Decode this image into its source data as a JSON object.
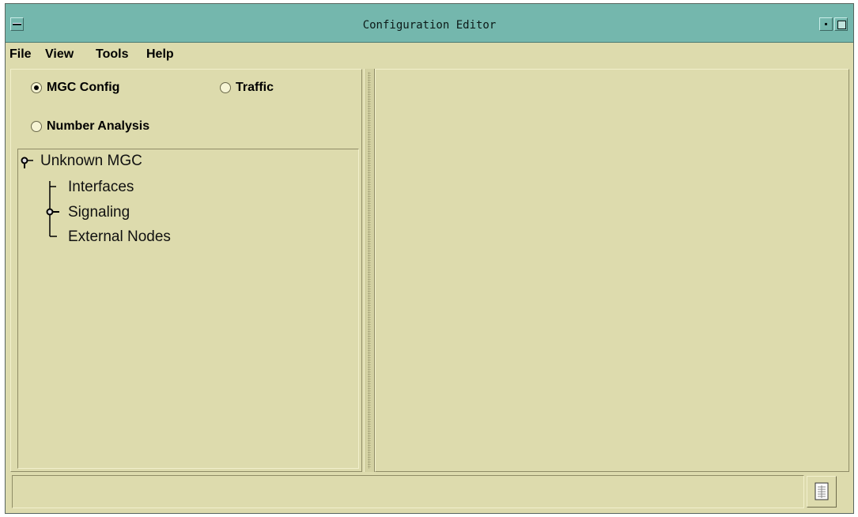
{
  "window": {
    "title": "Configuration Editor"
  },
  "menubar": {
    "items": [
      "File",
      "View",
      "Tools",
      "Help"
    ]
  },
  "mode": {
    "options": [
      "MGC Config",
      "Traffic",
      "Number Analysis"
    ],
    "selected": "MGC Config"
  },
  "tree": {
    "root": "Unknown MGC",
    "children": [
      "Interfaces",
      "Signaling",
      "External Nodes"
    ]
  },
  "statusbar": {
    "text": ""
  },
  "colors": {
    "titlebar": "#74b7ad",
    "panel": "#dddbad"
  }
}
